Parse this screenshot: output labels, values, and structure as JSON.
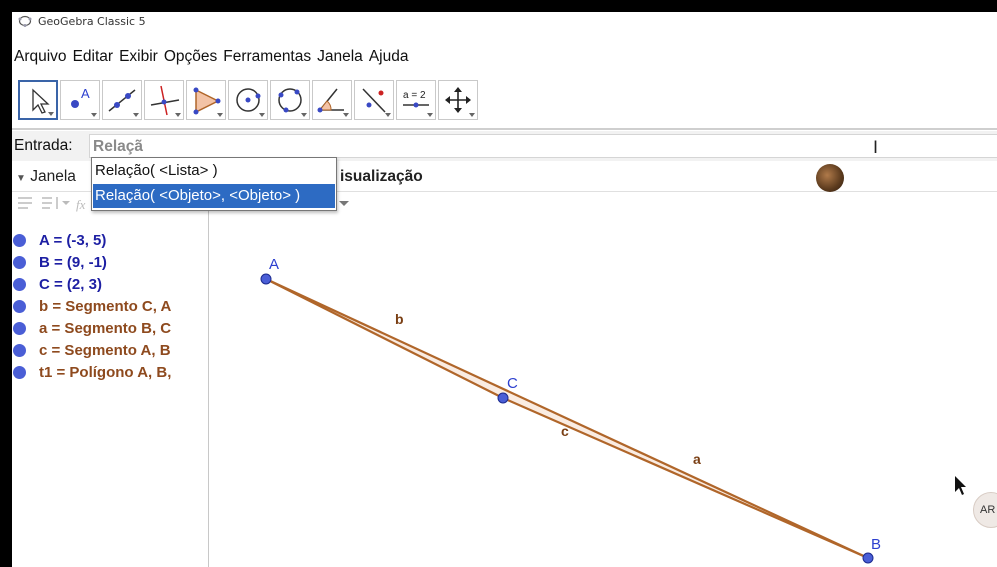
{
  "window": {
    "title": "GeoGebra Classic 5"
  },
  "menu": [
    "Arquivo",
    "Editar",
    "Exibir",
    "Opções",
    "Ferramentas",
    "Janela",
    "Ajuda"
  ],
  "toolbar": {
    "tools": [
      {
        "name": "move",
        "icon": "arrow-pointer-icon"
      },
      {
        "name": "point",
        "icon": "point-icon",
        "label": "A"
      },
      {
        "name": "line",
        "icon": "line-icon"
      },
      {
        "name": "perpendicular",
        "icon": "perpendicular-line-icon"
      },
      {
        "name": "polygon",
        "icon": "polygon-icon"
      },
      {
        "name": "circle",
        "icon": "circle-center-point-icon"
      },
      {
        "name": "circle-through-3",
        "icon": "circle-three-points-icon"
      },
      {
        "name": "angle",
        "icon": "angle-icon"
      },
      {
        "name": "reflect",
        "icon": "reflect-icon"
      },
      {
        "name": "slider",
        "icon": "slider-icon",
        "label": "a = 2"
      },
      {
        "name": "move-graphics",
        "icon": "move-graphics-icon"
      }
    ]
  },
  "input": {
    "label": "Entrada:",
    "value": "Relaçã"
  },
  "autocomplete": {
    "options": [
      "Relação( <Lista> )",
      "Relação( <Objeto>, <Objeto> )"
    ],
    "selected_index": 1
  },
  "views": {
    "algebra_header": "Janela",
    "graphics_header": "isualização"
  },
  "algebra": {
    "items": [
      {
        "text": "A = (-3, 5)",
        "kind": "point"
      },
      {
        "text": "B = (9, -1)",
        "kind": "point"
      },
      {
        "text": "C = (2, 3)",
        "kind": "point"
      },
      {
        "text": "b = Segmento C, A",
        "kind": "object"
      },
      {
        "text": "a = Segmento B, C",
        "kind": "object"
      },
      {
        "text": "c = Segmento A, B",
        "kind": "object"
      },
      {
        "text": "t1 = Polígono A, B,",
        "kind": "object"
      }
    ]
  },
  "graphics": {
    "labels": {
      "A": "A",
      "B": "B",
      "C": "C",
      "a": "a",
      "b": "b",
      "c": "c"
    },
    "colors": {
      "point": "#4a5ed6",
      "segment": "#b0662a",
      "label_point": "#2c3fcf",
      "label_segment": "#7a3f14"
    }
  },
  "ar_badge": "AR"
}
